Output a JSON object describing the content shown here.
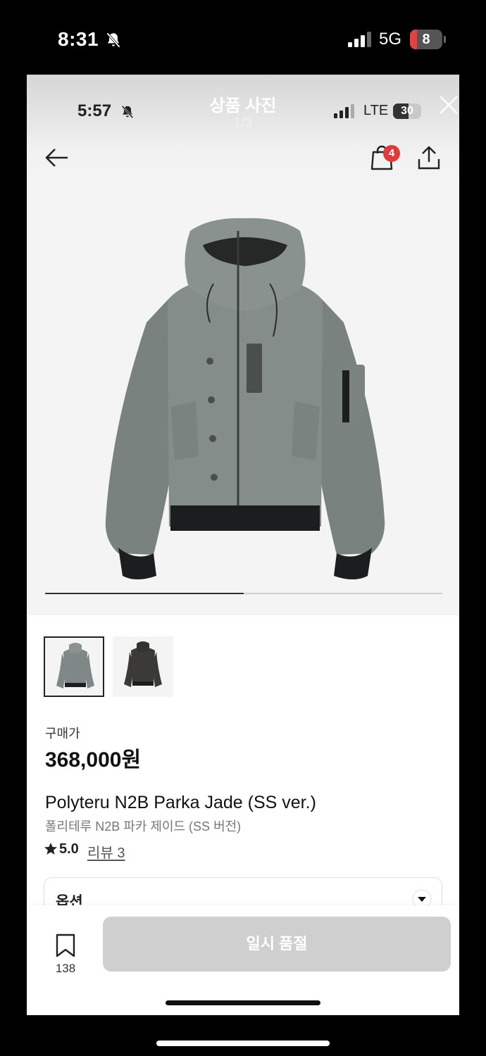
{
  "outer_status": {
    "time": "8:31",
    "network": "5G",
    "battery": "8"
  },
  "inner_status": {
    "time": "5:57",
    "network": "LTE",
    "battery": "30"
  },
  "viewer": {
    "title": "상품 사진",
    "counter": "1/3",
    "progress": 0.5
  },
  "nav": {
    "cart_badge": "4",
    "icons": [
      "back-arrow-icon",
      "shopping-bag-icon",
      "share-icon",
      "close-icon"
    ]
  },
  "product": {
    "price_label": "구매가",
    "price": "368,000원",
    "name": "Polyteru N2B Parka Jade (SS ver.)",
    "name_kr": "폴리테루 N2B 파카 제이드 (SS 버전)",
    "rating": "5.0",
    "review_link": "리뷰 3",
    "thumbnail_colors": [
      "#7f8886",
      "#3b3a36"
    ]
  },
  "option": {
    "label": "옵션"
  },
  "bottom": {
    "bookmark_count": "138",
    "button_label": "일시 품절"
  }
}
